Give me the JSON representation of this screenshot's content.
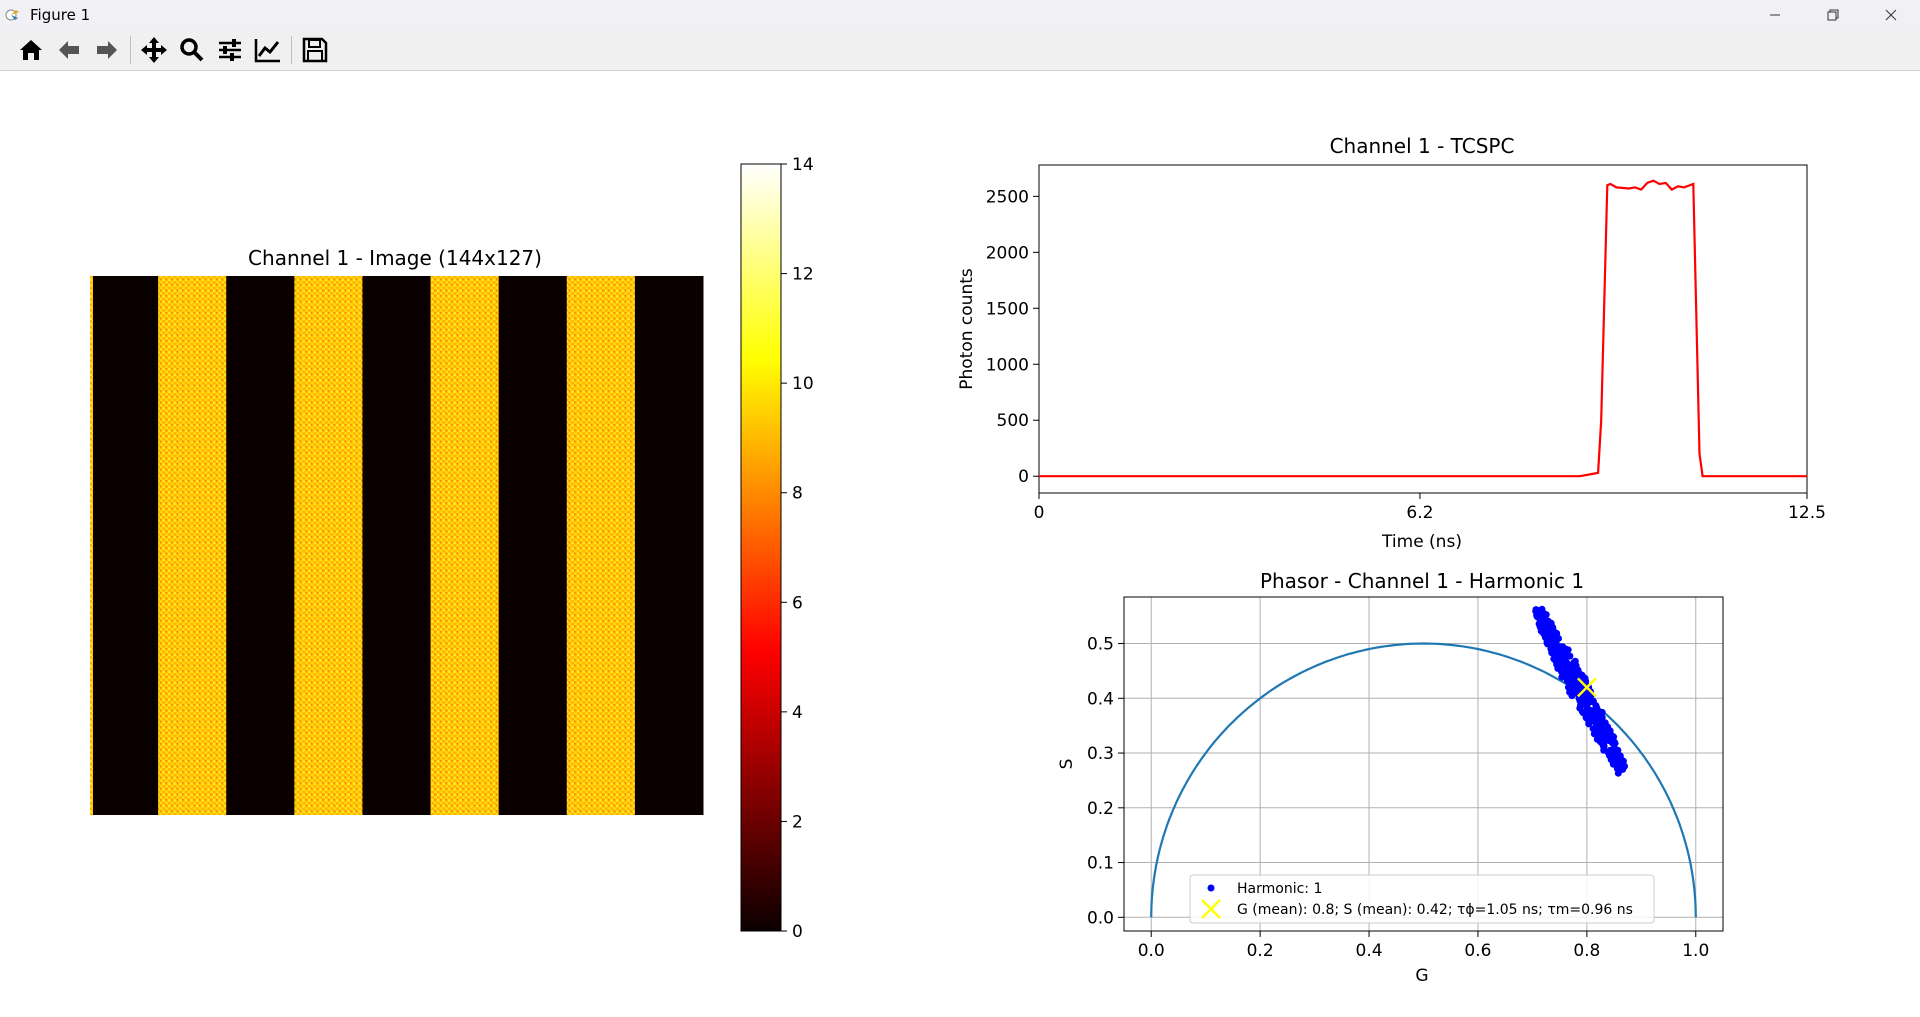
{
  "window": {
    "title": "Figure 1"
  },
  "toolbar": {
    "buttons": [
      {
        "name": "home-button",
        "icon": "home-icon"
      },
      {
        "name": "back-button",
        "icon": "arrow-left-icon"
      },
      {
        "name": "forward-button",
        "icon": "arrow-right-icon"
      },
      {
        "name": "pan-button",
        "icon": "move-icon"
      },
      {
        "name": "zoom-button",
        "icon": "magnifier-icon"
      },
      {
        "name": "configure-subplots-button",
        "icon": "sliders-icon"
      },
      {
        "name": "edit-axes-button",
        "icon": "line-chart-icon"
      },
      {
        "name": "save-button",
        "icon": "floppy-disk-icon"
      }
    ]
  },
  "chart_data": [
    {
      "type": "heatmap",
      "title": "Channel 1 - Image (144x127)",
      "colormap": "hot",
      "colorbar_ticks": [
        "0",
        "2",
        "4",
        "6",
        "8",
        "10",
        "12",
        "14"
      ],
      "vmin": 0,
      "vmax": 14,
      "stripes": [
        {
          "kind": "dark",
          "value": 0
        },
        {
          "kind": "checker",
          "values": [
            9,
            13
          ]
        },
        {
          "kind": "dark",
          "value": 0
        },
        {
          "kind": "checker",
          "values": [
            9,
            13
          ]
        },
        {
          "kind": "dark",
          "value": 0
        },
        {
          "kind": "checker",
          "values": [
            9,
            13
          ]
        },
        {
          "kind": "dark",
          "value": 0
        },
        {
          "kind": "checker",
          "values": [
            9,
            13
          ]
        },
        {
          "kind": "dark",
          "value": 0
        }
      ]
    },
    {
      "type": "line",
      "title": "Channel 1 - TCSPC",
      "xlabel": "Time (ns)",
      "ylabel": "Photon counts",
      "xlim": [
        0,
        12.5
      ],
      "ylim": [
        -150,
        2780
      ],
      "xticks": [
        0,
        6.2,
        12.5
      ],
      "xtick_labels": [
        "0",
        "6.2",
        "12.5"
      ],
      "yticks": [
        0,
        500,
        1000,
        1500,
        2000,
        2500
      ],
      "ytick_labels": [
        "0",
        "500",
        "1000",
        "1500",
        "2000",
        "2500"
      ],
      "color": "#ff0000",
      "series": [
        {
          "x": [
            0,
            8.8,
            9.0,
            9.1,
            9.15,
            9.25,
            9.3,
            9.4,
            9.6,
            9.7,
            9.8,
            9.9,
            10.0,
            10.1,
            10.2,
            10.3,
            10.4,
            10.5,
            10.65,
            10.75,
            10.8,
            12.5
          ],
          "y": [
            0,
            0,
            20,
            30,
            500,
            2600,
            2610,
            2580,
            2570,
            2580,
            2560,
            2620,
            2640,
            2610,
            2620,
            2560,
            2590,
            2580,
            2610,
            200,
            0,
            0
          ]
        }
      ]
    },
    {
      "type": "scatter",
      "title": "Phasor - Channel 1 - Harmonic 1",
      "xlabel": "G",
      "ylabel": "S",
      "xlim": [
        -0.05,
        1.05
      ],
      "ylim": [
        -0.025,
        0.585
      ],
      "xticks": [
        0.0,
        0.2,
        0.4,
        0.6,
        0.8,
        1.0
      ],
      "xtick_labels": [
        "0.0",
        "0.2",
        "0.4",
        "0.6",
        "0.8",
        "1.0"
      ],
      "yticks": [
        0.0,
        0.1,
        0.2,
        0.3,
        0.4,
        0.5
      ],
      "ytick_labels": [
        "0.0",
        "0.1",
        "0.2",
        "0.3",
        "0.4",
        "0.5"
      ],
      "grid": true,
      "semicircle": {
        "center": [
          0.5,
          0
        ],
        "radius": 0.5,
        "color": "#1f77b4"
      },
      "cluster": {
        "g_start": 0.71,
        "s_start": 0.56,
        "g_end": 0.865,
        "s_end": 0.27,
        "spread": 0.012,
        "color": "#0000ff"
      },
      "mean_marker": {
        "g": 0.8,
        "s": 0.42,
        "color": "#ffff00"
      },
      "legend": {
        "placement": "lower center",
        "entries": [
          {
            "label": "Harmonic: 1",
            "marker": "dot",
            "color": "#0000ff"
          },
          {
            "label": "G (mean): 0.8; S (mean): 0.42; τϕ=1.05 ns; τm=0.96 ns",
            "marker": "x",
            "color": "#ffff00"
          }
        ]
      }
    }
  ]
}
